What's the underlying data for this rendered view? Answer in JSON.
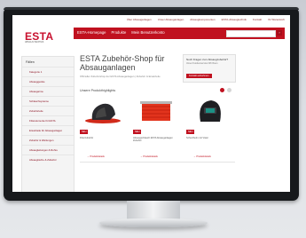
{
  "top_nav": [
    "Über Absauganlagen",
    "Unser Absauganlagen",
    "Absaugkomponenten",
    "ESTA-Absaugtechnik",
    "Kontakt",
    "Ihr Warenkorb"
  ],
  "logo": {
    "text": "ESTA",
    "sub": "ABSAUGTECHNIK"
  },
  "main_menu": [
    "ESTA-Homepage",
    "Produkte",
    "Mein Benutzerkonto"
  ],
  "search": {
    "placeholder": "",
    "button": "›"
  },
  "sidebar": {
    "title": "Fällen",
    "items": [
      "Kategorie 1",
      "Absauggeräte",
      "Absaugarme",
      "Schlauchsysteme",
      "Zubehörteile",
      "Filterelemente für ESTA",
      "Ersatzteile für Absauganlagen",
      "Zubehör & Wartungen",
      "Absaugleitungen & Rohre",
      "Absaugtische & Zubehör"
    ]
  },
  "main": {
    "heading": "ESTA Zubehör-Shop für Absauganlagen",
    "desc": "Offizieller Zubehörshop der ESTA Absauganlagen | Zubehör & Ersatzteile"
  },
  "promo": {
    "title": "Noch Fragen zum Absaugzubehör?",
    "text": "Unser Kundenservice hilft Ihnen",
    "button": "Kontakt aufnehmen"
  },
  "section_title": "Unsere Produkthighlights",
  "products": [
    {
      "badge": "NEU",
      "name": "Filterzubehör",
      "link": "→ Produktdetails"
    },
    {
      "badge": "NEU",
      "name": "Absaugschlauch ESTA Absauganlagen Zubehör",
      "link": "→ Produktdetails"
    },
    {
      "badge": "NEU",
      "name": "Schutzhelm mit Visier",
      "link": "→ Produktdetails"
    }
  ],
  "colors": {
    "brand_red": "#c0111f",
    "bezel": "#17191c"
  }
}
